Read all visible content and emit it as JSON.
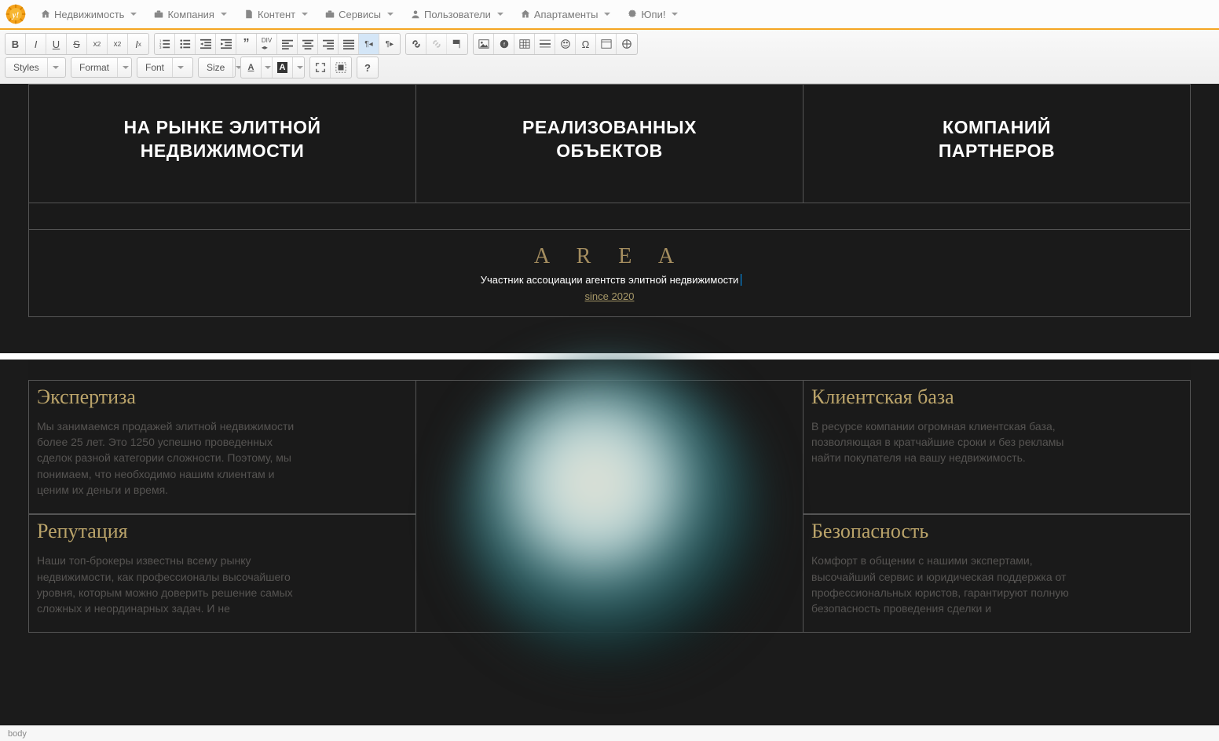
{
  "nav": {
    "items": [
      {
        "icon": "home-icon",
        "label": "Недвижимость"
      },
      {
        "icon": "briefcase-icon",
        "label": "Компания"
      },
      {
        "icon": "file-icon",
        "label": "Контент"
      },
      {
        "icon": "briefcase-icon",
        "label": "Сервисы"
      },
      {
        "icon": "user-icon",
        "label": "Пользователи"
      },
      {
        "icon": "home-icon",
        "label": "Апартаменты"
      },
      {
        "icon": "gear-icon",
        "label": "Юпи!"
      }
    ]
  },
  "toolbar": {
    "styles_label": "Styles",
    "format_label": "Format",
    "font_label": "Font",
    "size_label": "Size",
    "help_label": "?"
  },
  "content": {
    "stats": [
      {
        "line1": "НА РЫНКЕ ЭЛИТНОЙ",
        "line2": "НЕДВИЖИМОСТИ"
      },
      {
        "line1": "РЕАЛИЗОВАННЫХ",
        "line2": "ОБЪЕКТОВ"
      },
      {
        "line1": "КОМПАНИЙ",
        "line2": "ПАРТНЕРОВ"
      }
    ],
    "area": {
      "logo": "A R E A",
      "subtitle": "Участник ассоциации агентств элитной недвижимости",
      "since": "since 2020"
    },
    "cards": {
      "a": {
        "title": "Экспертиза",
        "body": "Мы занимаемся продажей элитной недвижимости более 25 лет. Это 1250 успешно проведенных сделок разной категории сложности. Поэтому, мы понимаем, что необходимо нашим клиентам и ценим их деньги и время."
      },
      "b": {
        "title": "Клиентская база",
        "body": "В ресурсе компании огромная клиентская база, позволяющая в кратчайшие сроки и без рекламы найти покупателя на вашу недвижимость."
      },
      "c": {
        "title": "Репутация",
        "body": "Наши топ-брокеры известны всему рынку недвижимости, как профессионалы высочайшего уровня, которым можно доверить решение самых сложных и неординарных задач. И не"
      },
      "d": {
        "title": "Безопасность",
        "body": "Комфорт в общении с нашими экспертами, высочайший сервис и юридическая поддержка от профессиональных юристов, гарантируют полную безопасность проведения сделки и"
      }
    }
  },
  "status": {
    "path": "body"
  }
}
